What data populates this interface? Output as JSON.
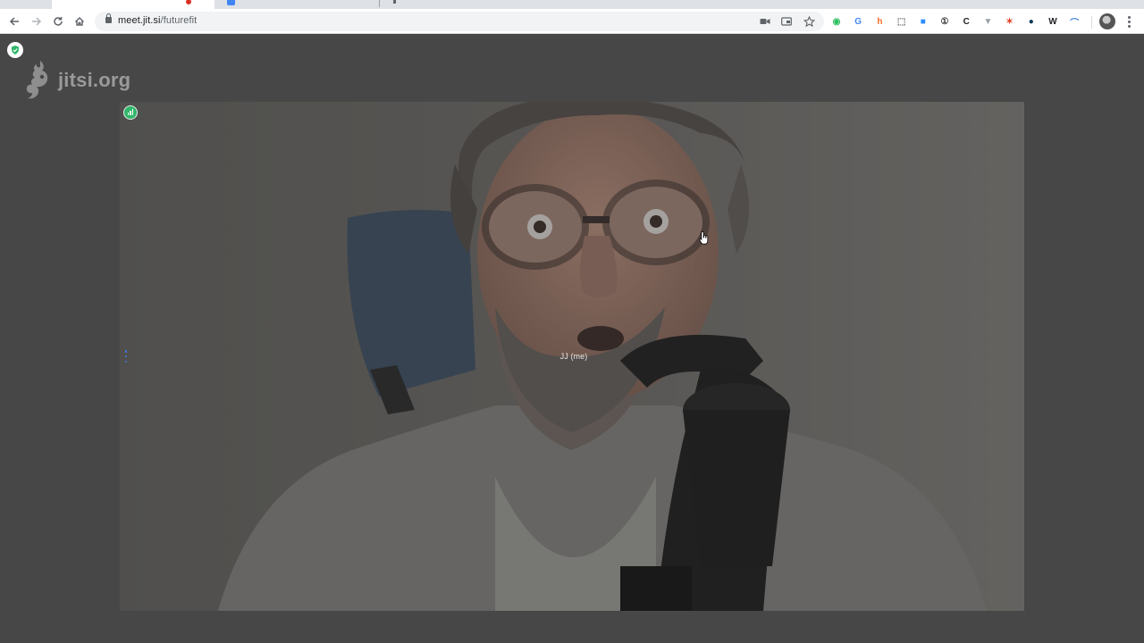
{
  "browser": {
    "url_host": "meet.jit.si",
    "url_path": "/futurefit",
    "nav": {
      "back": "back-arrow",
      "forward": "forward-arrow",
      "reload": "reload",
      "home": "home"
    },
    "extensions": [
      {
        "name": "evernote-icon",
        "glyph": "◉",
        "color": "#2dbe60"
      },
      {
        "name": "translate-icon",
        "glyph": "G",
        "color": "#4285f4"
      },
      {
        "name": "honey-icon",
        "glyph": "h",
        "color": "#f26c25"
      },
      {
        "name": "screenshot-icon",
        "glyph": "⬚",
        "color": "#5f6368"
      },
      {
        "name": "zoom-icon",
        "glyph": "■",
        "color": "#2d8cff"
      },
      {
        "name": "onepassword-icon",
        "glyph": "①",
        "color": "#3b3b3b"
      },
      {
        "name": "screencast-icon",
        "glyph": "C",
        "color": "#202124"
      },
      {
        "name": "shield-ext-icon",
        "glyph": "▼",
        "color": "#9aa0a6"
      },
      {
        "name": "puzzle-red-icon",
        "glyph": "✶",
        "color": "#e0482f"
      },
      {
        "name": "dark-circle-icon",
        "glyph": "●",
        "color": "#0e3a5a"
      },
      {
        "name": "wikipedia-icon",
        "glyph": "W",
        "color": "#202124"
      },
      {
        "name": "feather-icon",
        "glyph": "⌒",
        "color": "#3d7ee0"
      }
    ]
  },
  "jitsi": {
    "watermark_text": "jitsi.org",
    "participant_label": "JJ (me)",
    "connection_color": "#31b76a",
    "security_icon_color": "#31b76a"
  }
}
